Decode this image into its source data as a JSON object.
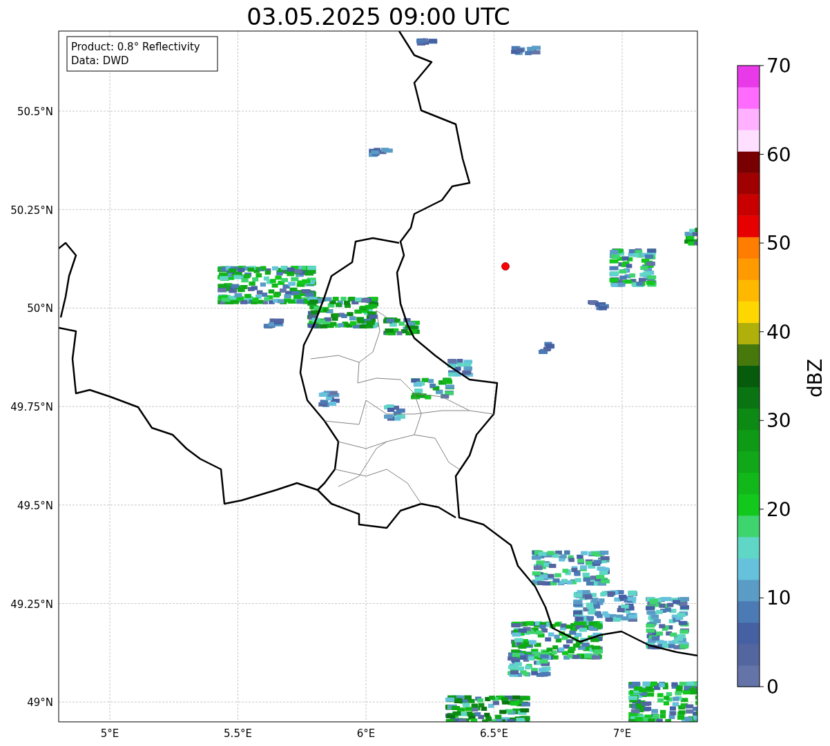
{
  "title": "03.05.2025 09:00 UTC",
  "legend": [
    "Product: 0.8° Reflectivity",
    "Data: DWD"
  ],
  "x_ticks": [
    "5°E",
    "5.5°E",
    "6°E",
    "6.5°E",
    "7°E"
  ],
  "y_ticks": [
    "50.5°N",
    "50.25°N",
    "50°N",
    "49.75°N",
    "49.5°N",
    "49.25°N",
    "49°N"
  ],
  "colorbar": {
    "label": "dBZ",
    "ticks": [
      "70",
      "60",
      "50",
      "40",
      "30",
      "20",
      "10",
      "0"
    ],
    "bins": [
      {
        "color": "#6474a8"
      },
      {
        "color": "#5466a0"
      },
      {
        "color": "#4660a4"
      },
      {
        "color": "#4b7ab4"
      },
      {
        "color": "#5a9cc6"
      },
      {
        "color": "#66c2dc"
      },
      {
        "color": "#5fd6c6"
      },
      {
        "color": "#3ed46e"
      },
      {
        "color": "#12c81c"
      },
      {
        "color": "#12b81a"
      },
      {
        "color": "#10a818"
      },
      {
        "color": "#0f9a16"
      },
      {
        "color": "#0d8a14"
      },
      {
        "color": "#0a7412"
      },
      {
        "color": "#065c0c"
      },
      {
        "color": "#46780c"
      },
      {
        "color": "#b0b00a"
      },
      {
        "color": "#ffd700"
      },
      {
        "color": "#ffb800"
      },
      {
        "color": "#ff9a00"
      },
      {
        "color": "#ff7d00"
      },
      {
        "color": "#e60000"
      },
      {
        "color": "#c80000"
      },
      {
        "color": "#a00000"
      },
      {
        "color": "#780000"
      },
      {
        "color": "#ffdfff"
      },
      {
        "color": "#ffb0ff"
      },
      {
        "color": "#ff6aff"
      },
      {
        "color": "#e83ae8"
      }
    ]
  }
}
